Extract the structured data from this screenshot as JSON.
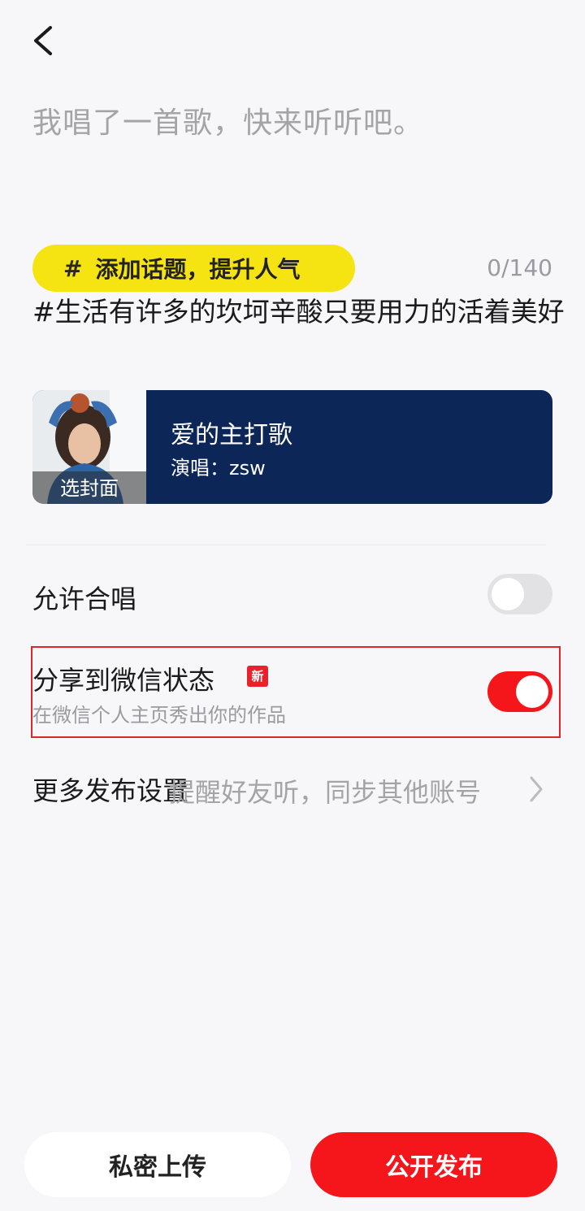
{
  "caption": "我唱了一首歌，快来听听吧。",
  "topic": {
    "hash": "#",
    "label": "添加话题，提升人气",
    "counter": "0/140"
  },
  "hashtag_text": "#生活有许多的坎坷辛酸只要用力的活着美好",
  "song": {
    "title": "爱的主打歌",
    "artist": "演唱：zsw",
    "cover_label": "选封面"
  },
  "settings": {
    "chorus_label": "允许合唱",
    "chorus_enabled": false,
    "wechat_label": "分享到微信状态",
    "wechat_badge": "新",
    "wechat_sub": "在微信个人主页秀出你的作品",
    "wechat_enabled": true,
    "more_label": "更多发布设置",
    "more_hint": "提醒好友听，同步其他账号"
  },
  "buttons": {
    "private": "私密上传",
    "public": "公开发布"
  },
  "colors": {
    "accent_red": "#f4161b",
    "chip_yellow": "#f6e412",
    "card_navy": "#0d2658"
  },
  "icons": {
    "back": "chevron-left-icon",
    "more": "chevron-right-icon"
  }
}
